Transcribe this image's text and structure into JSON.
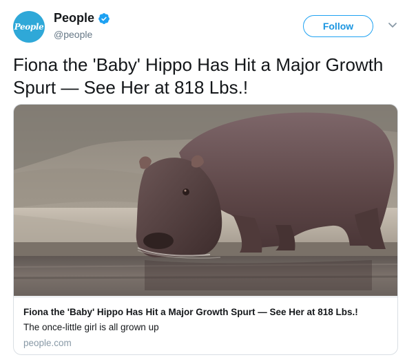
{
  "author": {
    "avatar_text": "People",
    "display_name": "People",
    "handle": "@people",
    "verified": true
  },
  "actions": {
    "follow_label": "Follow"
  },
  "tweet": {
    "text": "Fiona the 'Baby' Hippo Has Hit a Major Growth Spurt — See Her at 818 Lbs.!"
  },
  "card": {
    "image_description": "hippo-drinking-water",
    "title": "Fiona the 'Baby' Hippo Has Hit a Major Growth Spurt — See Her at 818 Lbs.!",
    "description": "The once-little girl is all grown up",
    "domain": "people.com"
  },
  "colors": {
    "brand": "#2fa8d8",
    "follow_accent": "#1da1f2",
    "verified": "#1da1f2"
  }
}
